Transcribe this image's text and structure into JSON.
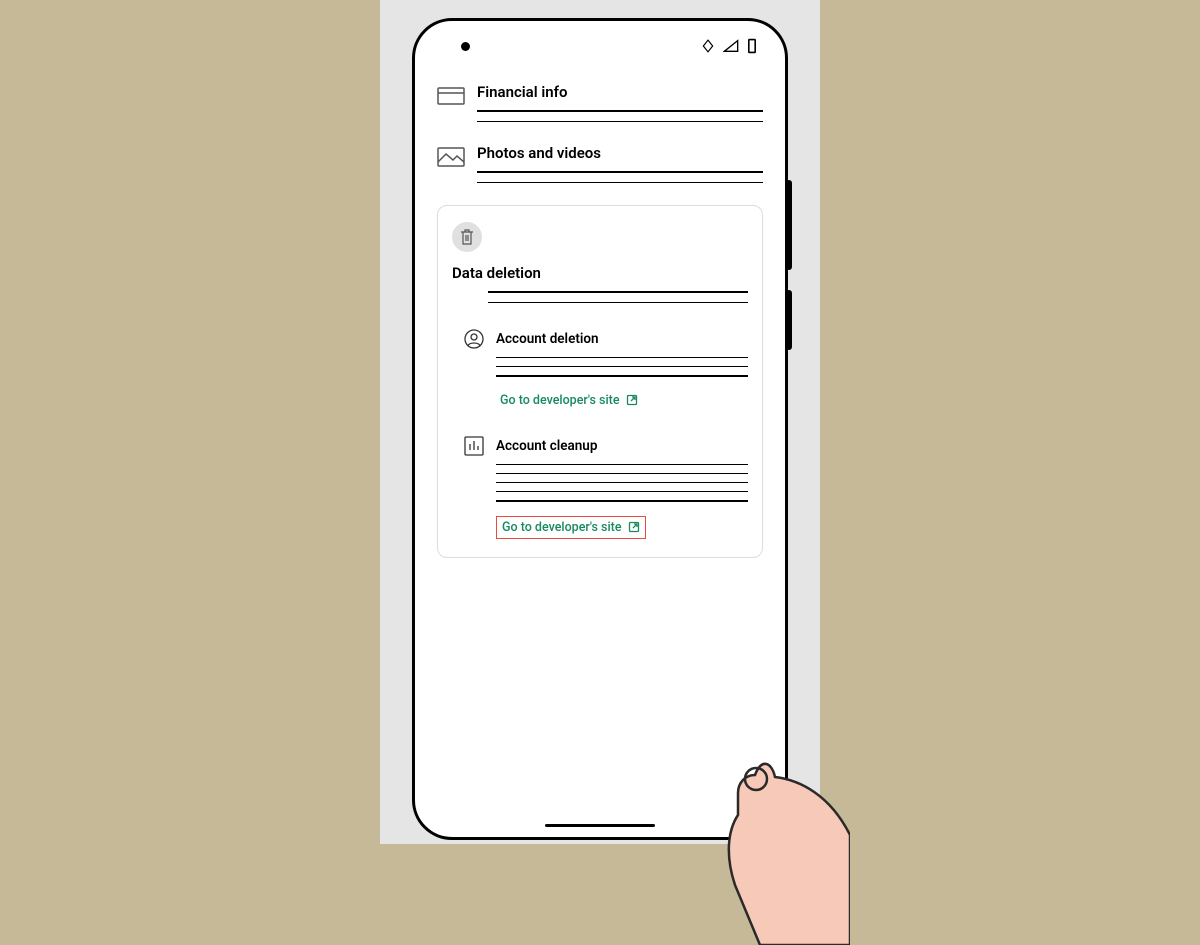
{
  "sections": {
    "financial": {
      "title": "Financial info"
    },
    "photos": {
      "title": "Photos and videos"
    }
  },
  "card": {
    "title": "Data deletion",
    "account_deletion": {
      "title": "Account deletion",
      "link_label": "Go to developer's site"
    },
    "account_cleanup": {
      "title": "Account cleanup",
      "link_label": "Go to developer's site"
    }
  },
  "colors": {
    "link": "#188a5e",
    "highlight": "#e74c3c"
  }
}
